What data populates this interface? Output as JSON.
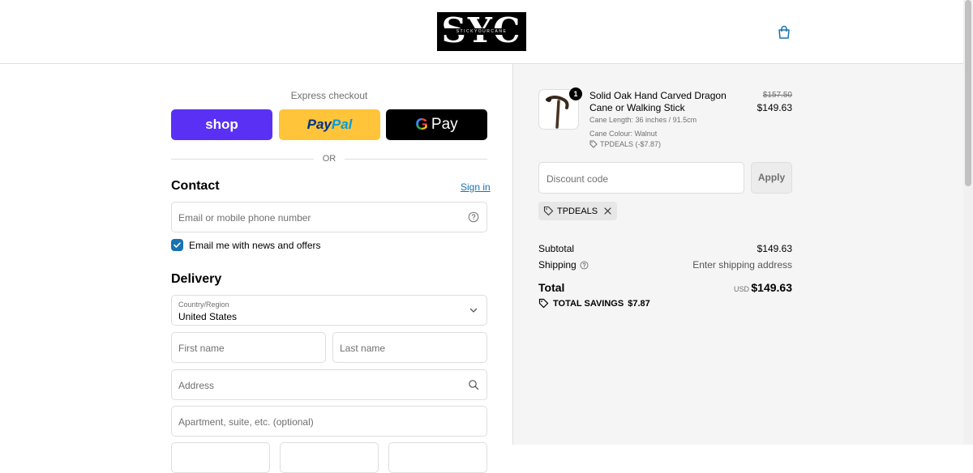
{
  "header": {
    "logo_main": "SYC",
    "logo_sub": "STICKYOURCANE",
    "cart_icon": "shopping-bag-icon"
  },
  "express": {
    "title": "Express checkout",
    "shop_label": "shop",
    "paypal_part1": "Pay",
    "paypal_part2": "Pal",
    "gpay_g": "G",
    "gpay_label": "Pay",
    "or_text": "OR"
  },
  "contact": {
    "title": "Contact",
    "signin_label": "Sign in",
    "email_placeholder": "Email or mobile phone number",
    "news_checkbox_label": "Email me with news and offers",
    "news_checked": true
  },
  "delivery": {
    "title": "Delivery",
    "country_label": "Country/Region",
    "country_value": "United States",
    "first_name_placeholder": "First name",
    "last_name_placeholder": "Last name",
    "address_placeholder": "Address",
    "apartment_placeholder": "Apartment, suite, etc. (optional)"
  },
  "summary": {
    "item": {
      "quantity": "1",
      "title": "Solid Oak Hand Carved Dragon Cane or Walking Stick",
      "cane_length": "Cane Length: 36 inches / 91.5cm",
      "cane_colour": "Cane Colour: Walnut",
      "item_discount": "TPDEALS (-$7.87)",
      "old_price": "$157.50",
      "price": "$149.63"
    },
    "discount_placeholder": "Discount code",
    "apply_label": "Apply",
    "applied_code": "TPDEALS",
    "subtotal_label": "Subtotal",
    "subtotal_value": "$149.63",
    "shipping_label": "Shipping",
    "shipping_value": "Enter shipping address",
    "total_label": "Total",
    "currency": "USD",
    "total_value": "$149.63",
    "savings_label": "TOTAL SAVINGS",
    "savings_value": "$7.87"
  },
  "colors": {
    "shop": "#5a31f4",
    "paypal": "#ffc439",
    "gpay": "#000000",
    "link": "#1773b0",
    "summary_bg": "#f5f5f5"
  }
}
